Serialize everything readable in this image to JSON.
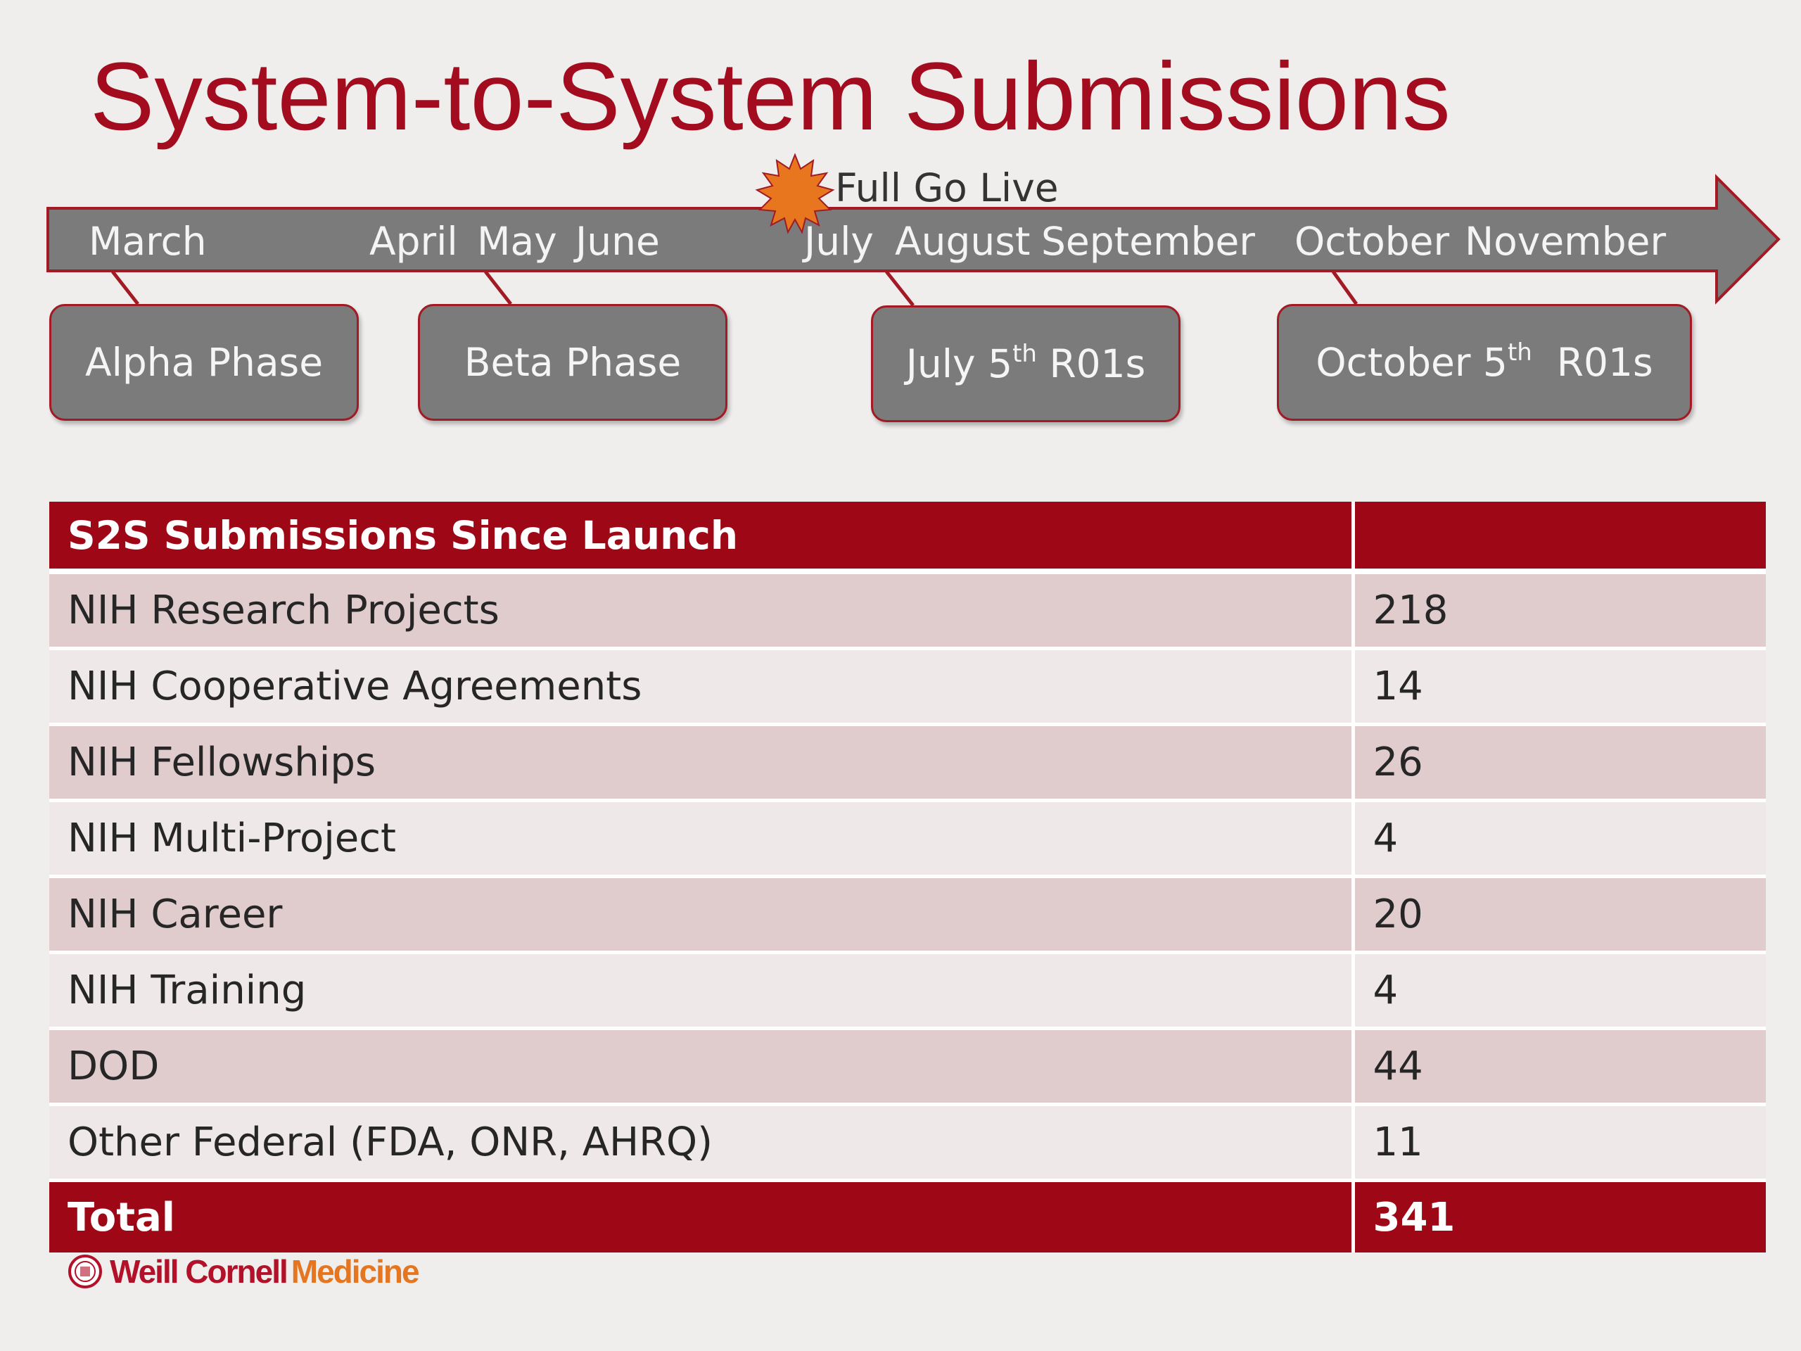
{
  "slide": {
    "title": "System-to-System Submissions"
  },
  "timeline": {
    "months": {
      "march": "March",
      "april": "April",
      "may": "May",
      "june": "June",
      "july": "July",
      "august": "August",
      "september": "September",
      "october": "October",
      "november": "November"
    },
    "go_live_label": "Full Go Live",
    "phases": {
      "alpha": "Alpha Phase",
      "beta": "Beta Phase",
      "july_prefix": "July 5",
      "july_sup": "th",
      "july_suffix": " R01s",
      "october_prefix": "October 5",
      "october_sup": "th",
      "october_suffix": "  R01s"
    },
    "colors": {
      "arrow": "#7b7b7b",
      "outline": "#a21a24",
      "starburst": "#e8761e"
    }
  },
  "table": {
    "header": {
      "label": "S2S Submissions Since Launch",
      "value": ""
    },
    "rows": [
      {
        "label": "NIH Research Projects",
        "value": "218"
      },
      {
        "label": "NIH Cooperative Agreements",
        "value": "14"
      },
      {
        "label": "NIH Fellowships",
        "value": "26"
      },
      {
        "label": "NIH Multi-Project",
        "value": "4"
      },
      {
        "label": "NIH Career",
        "value": "20"
      },
      {
        "label": "NIH Training",
        "value": "4"
      },
      {
        "label": "DOD",
        "value": "44"
      },
      {
        "label": "Other Federal (FDA, ONR, AHRQ)",
        "value": "11"
      }
    ],
    "total": {
      "label": "Total",
      "value": "341"
    },
    "colors": {
      "header": "#9e0816",
      "band_dark": "#e0cccd",
      "band_light": "#efe8e8"
    }
  },
  "footer": {
    "logo_word1": "Weill Cornell",
    "logo_word2": "Medicine",
    "logo_icon": "seal-icon"
  }
}
